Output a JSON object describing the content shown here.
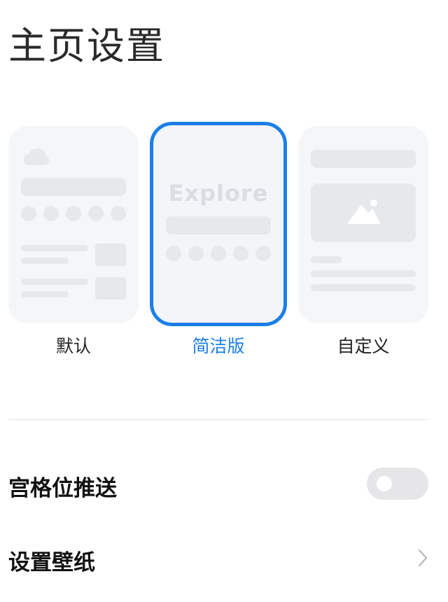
{
  "page": {
    "title": "主页设置"
  },
  "layouts": {
    "selected": "简洁版",
    "options": [
      {
        "label": "默认"
      },
      {
        "label": "简洁版",
        "preview_text": "Explore"
      },
      {
        "label": "自定义"
      }
    ]
  },
  "settings": {
    "grid_push": {
      "label": "宫格位推送",
      "enabled": false
    },
    "wallpaper": {
      "label": "设置壁纸"
    }
  },
  "colors": {
    "accent": "#1b7fe8",
    "card_bg": "#f5f6f8",
    "placeholder": "#e7e8ec",
    "toggle_off": "#e6e6e8"
  },
  "icons": {
    "cloud": "cloud-icon",
    "image": "image-icon",
    "chevron": "chevron-right-icon"
  }
}
